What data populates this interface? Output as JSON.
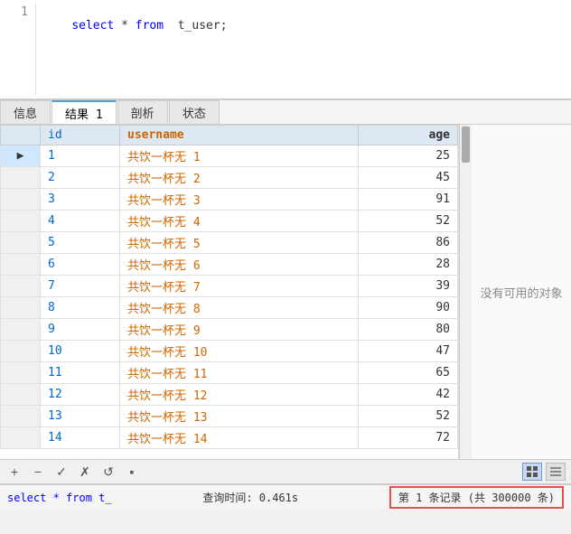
{
  "editor": {
    "line_number": "1",
    "sql_parts": {
      "select": "select",
      "star": " * ",
      "from": "from",
      "table": "  t_user;"
    }
  },
  "tabs": [
    {
      "id": "info",
      "label": "信息"
    },
    {
      "id": "result1",
      "label": "结果 1",
      "active": true
    },
    {
      "id": "profile",
      "label": "剖析"
    },
    {
      "id": "status",
      "label": "状态"
    }
  ],
  "table": {
    "columns": [
      "id",
      "username",
      "age"
    ],
    "rows": [
      {
        "id": "1",
        "username": "共饮一杯无 1",
        "age": "25"
      },
      {
        "id": "2",
        "username": "共饮一杯无 2",
        "age": "45"
      },
      {
        "id": "3",
        "username": "共饮一杯无 3",
        "age": "91"
      },
      {
        "id": "4",
        "username": "共饮一杯无 4",
        "age": "52"
      },
      {
        "id": "5",
        "username": "共饮一杯无 5",
        "age": "86"
      },
      {
        "id": "6",
        "username": "共饮一杯无 6",
        "age": "28"
      },
      {
        "id": "7",
        "username": "共饮一杯无 7",
        "age": "39"
      },
      {
        "id": "8",
        "username": "共饮一杯无 8",
        "age": "90"
      },
      {
        "id": "9",
        "username": "共饮一杯无 9",
        "age": "80"
      },
      {
        "id": "10",
        "username": "共饮一杯无 10",
        "age": "47"
      },
      {
        "id": "11",
        "username": "共饮一杯无 11",
        "age": "65"
      },
      {
        "id": "12",
        "username": "共饮一杯无 12",
        "age": "42"
      },
      {
        "id": "13",
        "username": "共饮一杯无 13",
        "age": "52"
      },
      {
        "id": "14",
        "username": "共饮一杯无 14",
        "age": "72"
      }
    ]
  },
  "right_panel": {
    "text": "没有可用的对象"
  },
  "toolbar": {
    "plus": "+",
    "minus": "−",
    "check": "✓",
    "cross": "✗",
    "refresh": "↺",
    "square": "▪"
  },
  "status_bar": {
    "sql_text": "select * from  t_",
    "query_time": "查询时间: 0.461s",
    "record_info": "第 1 条记录 (共 300000 条)"
  }
}
